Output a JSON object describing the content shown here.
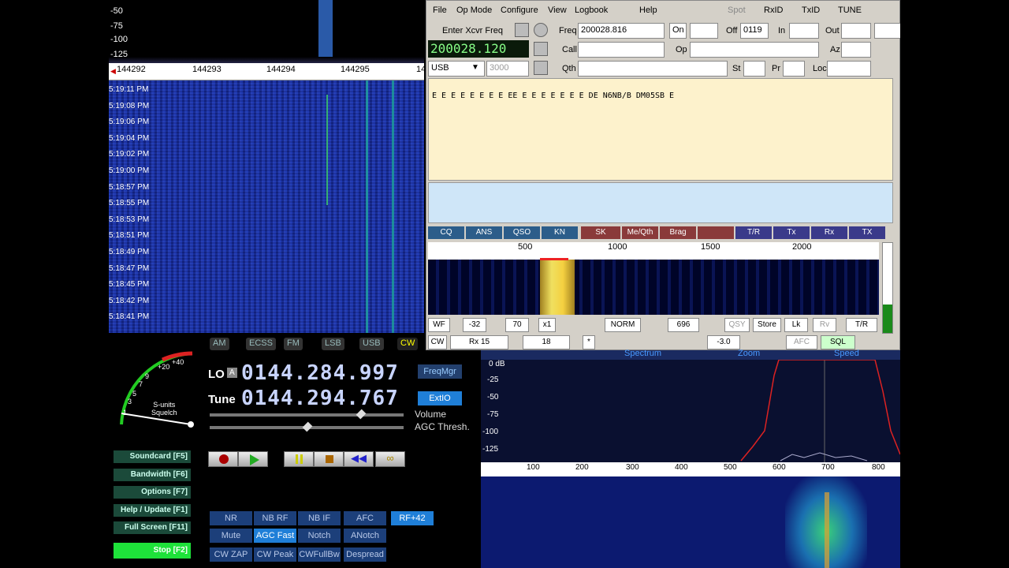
{
  "sdr": {
    "db_labels": [
      "-50",
      "-75",
      "-100",
      "-125"
    ],
    "ruler_ticks": [
      "144292",
      "144293",
      "144294",
      "144295",
      "14"
    ],
    "timestamps": [
      "5:19:11 PM",
      "5:19:08 PM",
      "5:19:06 PM",
      "5:19:04 PM",
      "5:19:02 PM",
      "5:19:00 PM",
      "5:18:57 PM",
      "5:18:55 PM",
      "5:18:53 PM",
      "5:18:51 PM",
      "5:18:49 PM",
      "5:18:47 PM",
      "5:18:45 PM",
      "5:18:42 PM",
      "5:18:41 PM"
    ],
    "modes": [
      "AM",
      "ECSS",
      "FM",
      "LSB",
      "USB",
      "CW"
    ],
    "lo_label": "LO",
    "lo_a": "A",
    "lo_value": "0144.284.997",
    "tune_label": "Tune",
    "tune_value": "0144.294.767",
    "freqmgr": "FreqMgr",
    "extio": "ExtIO",
    "volume": "Volume",
    "agc_thresh": "AGC Thresh.",
    "smeter_labels": [
      "+40",
      "+20",
      "9",
      "7",
      "5",
      "3",
      "1"
    ],
    "smeter_caption": "S-units\nSquelch",
    "side_buttons": [
      "Soundcard  [F5]",
      "Bandwidth  [F6]",
      "Options  [F7]",
      "Help / Update  [F1]",
      "Full Screen  [F11]",
      "Stop  [F2]"
    ],
    "dsp_row1": [
      "NR",
      "NB RF",
      "NB IF",
      "AFC",
      "RF+42"
    ],
    "dsp_row2": [
      "Mute",
      "AGC Fast",
      "Notch",
      "ANotch"
    ],
    "dsp_row3": [
      "CW ZAP",
      "CW Peak",
      "CWFullBw",
      "Despread"
    ]
  },
  "fldigi": {
    "menus": [
      "File",
      "Op Mode",
      "Configure",
      "View",
      "Logbook",
      "Help"
    ],
    "toggles": [
      "Spot",
      "RxID",
      "TxID",
      "TUNE"
    ],
    "enter_xcvr": "Enter Xcvr Freq",
    "freq_label": "Freq",
    "freq_value": "200028.816",
    "on_label": "On",
    "off_label": "Off",
    "off_value": "0119",
    "in_label": "In",
    "out_label": "Out",
    "lcd_freq": "200028.120",
    "call_label": "Call",
    "op_label": "Op",
    "az_label": "Az",
    "mode_value": "USB",
    "bw_value": "3000",
    "qth_label": "Qth",
    "st_label": "St",
    "pr_label": "Pr",
    "loc_label": "Loc",
    "rx_text": "E E E E E E E E EE E E E E E E E DE N6NB/B DM05SB E",
    "macros": [
      "CQ",
      "ANS",
      "QSO",
      "KN",
      "SK",
      "Me/Qth",
      "Brag",
      "",
      "T/R",
      "Tx",
      "Rx",
      "TX"
    ],
    "wf_ticks": [
      "500",
      "1000",
      "1500",
      "2000"
    ],
    "ctrl_row": {
      "wf": "WF",
      "a": "-32",
      "b": "70",
      "x1": "x1",
      "norm": "NORM",
      "c": "696",
      "qsy": "QSY",
      "store": "Store",
      "lk": "Lk",
      "rv": "Rv",
      "tr": "T/R"
    },
    "status_row": {
      "mode": "CW",
      "rx": "Rx 15",
      "val": "18",
      "star": "*",
      "db": "-3.0",
      "afc": "AFC",
      "sql": "SQL"
    }
  },
  "spectrum": {
    "title_a": "Spectrum",
    "title_b": "Zoom",
    "title_c": "Speed",
    "db_labels": [
      "0 dB",
      "-25",
      "-50",
      "-75",
      "-100",
      "-125"
    ],
    "ruler_ticks": [
      "100",
      "200",
      "300",
      "400",
      "500",
      "600",
      "700",
      "800"
    ]
  }
}
